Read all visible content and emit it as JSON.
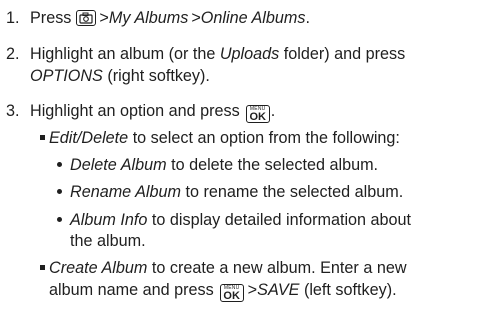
{
  "steps": [
    {
      "num": "1.",
      "press": "Press",
      "gt1": ">",
      "path1": "My Albums",
      "gt2": ">",
      "path2": "Online Albums",
      "period": "."
    },
    {
      "num": "2.",
      "text1": "Highlight an album (or the",
      "uploads": "Uploads",
      "text2": "folder) and press",
      "options": "OPTIONS",
      "text3": "(right softkey)."
    },
    {
      "num": "3.",
      "text1": "Highlight an option and press",
      "period": "."
    }
  ],
  "sub": {
    "edit_delete": "Edit/Delete",
    "edit_delete_text": "to select an option from the following:",
    "delete_album": "Delete Album",
    "delete_album_text": "to delete the selected album.",
    "rename_album": "Rename Album",
    "rename_album_text": "to rename the selected album.",
    "album_info": "Album Info",
    "album_info_text1": "to display detailed information about",
    "album_info_text2": "the album.",
    "create_album": "Create Album",
    "create_album_text1": "to create a new album. Enter a new",
    "create_album_text2": "album name and press",
    "gt": ">",
    "save": "SAVE",
    "create_album_text3": "(left softkey)."
  },
  "keys": {
    "menu_label": "MENU",
    "ok_label": "OK"
  },
  "icons": {
    "camera_key": "camera-key-icon",
    "menu_ok_key": "menu-ok-key-icon"
  }
}
